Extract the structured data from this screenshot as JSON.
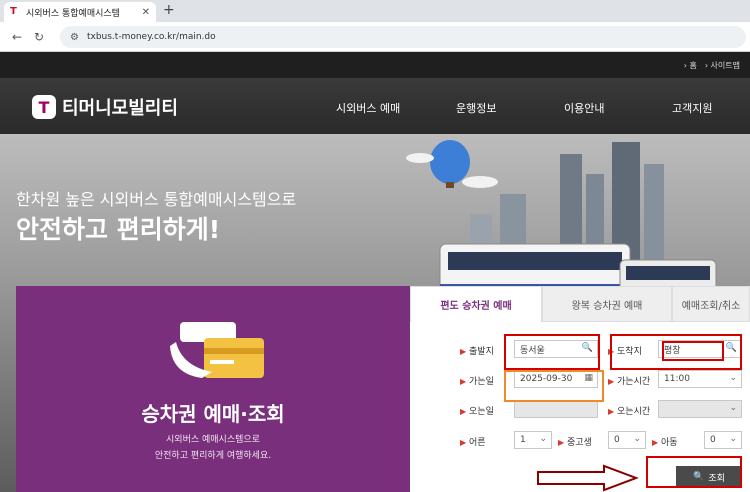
{
  "browser": {
    "tab_title": "시외버스 통합예매시스템",
    "tab_icon": "T",
    "new_tab": "+",
    "url": "txbus.t-money.co.kr/main.do"
  },
  "header": {
    "util_links": [
      "› 홈",
      "› 사이트맵"
    ],
    "logo_mark": "T",
    "logo_text": "티머니모빌리티",
    "nav": [
      "시외버스 예매",
      "운행정보",
      "이용안내",
      "고객지원"
    ]
  },
  "hero": {
    "subtitle": "한차원 높은 시외버스 통합예매시스템으로",
    "title": "안전하고 편리하게!"
  },
  "promo": {
    "title": "승차권 예매·조회",
    "desc_line1": "시외버스 예매시스템으로",
    "desc_line2": "안전하고 편리하게 여행하세요."
  },
  "booking": {
    "tabs": [
      "편도 승차권 예매",
      "왕복 승차권 예매",
      "예매조회/취소"
    ],
    "departure": {
      "label": "출발지",
      "value": "동서울"
    },
    "arrival": {
      "label": "도착지",
      "value": "평창"
    },
    "go_date": {
      "label": "가는일",
      "value": "2025-09-30"
    },
    "go_time": {
      "label": "가는시간",
      "value": "11:00"
    },
    "come_date": {
      "label": "오는일",
      "value": ""
    },
    "come_time": {
      "label": "오는시간",
      "value": ""
    },
    "adult": {
      "label": "어른",
      "value": "1"
    },
    "student": {
      "label": "중고생",
      "value": "0"
    },
    "child": {
      "label": "아동",
      "value": "0"
    },
    "search_label": "조회"
  },
  "colors": {
    "brand_purple": "#7a2f7c",
    "annotation_red": "#d40000",
    "annotation_orange": "#f08a28"
  }
}
